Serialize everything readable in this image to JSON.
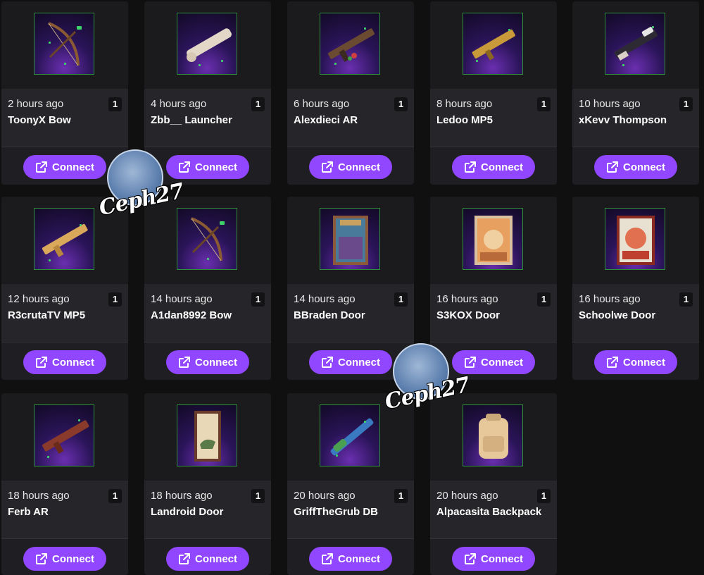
{
  "items": [
    {
      "time": "2 hours ago",
      "name": "ToonyX Bow",
      "qty": "1",
      "button": "Connect",
      "icon": "bow-icon"
    },
    {
      "time": "4 hours ago",
      "name": "Zbb__ Launcher",
      "qty": "1",
      "button": "Connect",
      "icon": "launcher-icon"
    },
    {
      "time": "6 hours ago",
      "name": "Alexdieci AR",
      "qty": "1",
      "button": "Connect",
      "icon": "assault-rifle-icon"
    },
    {
      "time": "8 hours ago",
      "name": "Ledoo MP5",
      "qty": "1",
      "button": "Connect",
      "icon": "smg-icon"
    },
    {
      "time": "10 hours ago",
      "name": "xKevv Thompson",
      "qty": "1",
      "button": "Connect",
      "icon": "thompson-icon"
    },
    {
      "time": "12 hours ago",
      "name": "R3crutaTV MP5",
      "qty": "1",
      "button": "Connect",
      "icon": "smg-icon"
    },
    {
      "time": "14 hours ago",
      "name": "A1dan8992 Bow",
      "qty": "1",
      "button": "Connect",
      "icon": "bow-icon"
    },
    {
      "time": "14 hours ago",
      "name": "BBraden Door",
      "qty": "1",
      "button": "Connect",
      "icon": "door-icon"
    },
    {
      "time": "16 hours ago",
      "name": "S3KOX Door",
      "qty": "1",
      "button": "Connect",
      "icon": "door-icon"
    },
    {
      "time": "16 hours ago",
      "name": "Schoolwe Door",
      "qty": "1",
      "button": "Connect",
      "icon": "door-icon"
    },
    {
      "time": "18 hours ago",
      "name": "Ferb AR",
      "qty": "1",
      "button": "Connect",
      "icon": "assault-rifle-icon"
    },
    {
      "time": "18 hours ago",
      "name": "Landroid Door",
      "qty": "1",
      "button": "Connect",
      "icon": "door-icon"
    },
    {
      "time": "20 hours ago",
      "name": "GriffTheGrub DB",
      "qty": "1",
      "button": "Connect",
      "icon": "double-barrel-icon"
    },
    {
      "time": "20 hours ago",
      "name": "Alpacasita Backpack",
      "qty": "1",
      "button": "Connect",
      "icon": "backpack-icon"
    }
  ],
  "watermark": {
    "text": "Ceph27"
  },
  "colors": {
    "accent": "#9146ff",
    "card": "#1f1f23",
    "info": "#26262a",
    "background": "#101010"
  }
}
